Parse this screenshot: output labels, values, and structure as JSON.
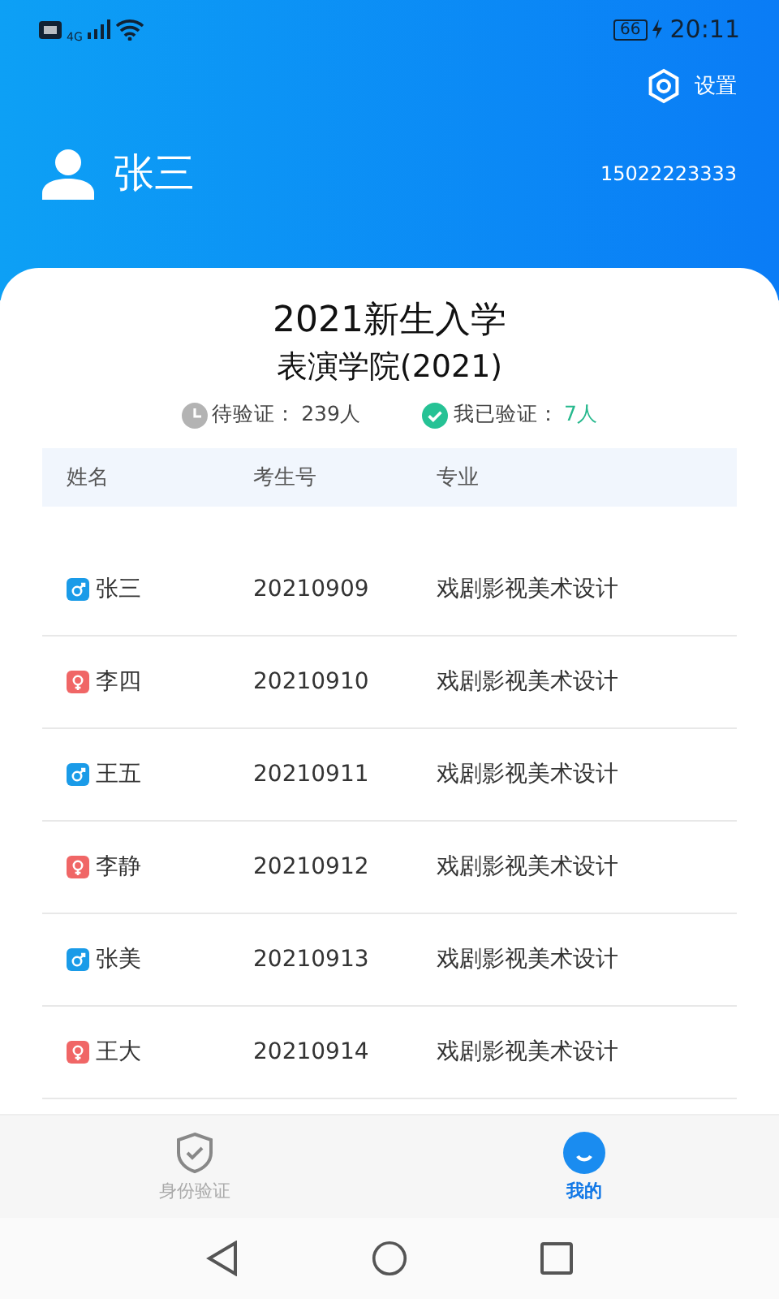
{
  "status_bar": {
    "network": "4G",
    "battery": "66",
    "time": "20:11"
  },
  "header": {
    "settings": "设置",
    "user_name": "张三",
    "phone": "15022223333"
  },
  "card": {
    "title": "2021新生入学",
    "subtitle": "表演学院(2021)",
    "stats": [
      {
        "kind": "pending",
        "label": "待验证：",
        "value": "239人"
      },
      {
        "kind": "verified",
        "label": "我已验证：",
        "value": "7人"
      }
    ]
  },
  "table": {
    "columns": [
      "姓名",
      "考生号",
      "专业"
    ],
    "rows": [
      {
        "kind": "male",
        "name": "张三",
        "id": "20210909",
        "major": "戏剧影视美术设计"
      },
      {
        "kind": "female",
        "name": "李四",
        "id": "20210910",
        "major": "戏剧影视美术设计"
      },
      {
        "kind": "male",
        "name": "王五",
        "id": "20210911",
        "major": "戏剧影视美术设计"
      },
      {
        "kind": "female",
        "name": "李静",
        "id": "20210912",
        "major": "戏剧影视美术设计"
      },
      {
        "kind": "male",
        "name": "张美",
        "id": "20210913",
        "major": "戏剧影视美术设计"
      },
      {
        "kind": "female",
        "name": "王大",
        "id": "20210914",
        "major": "戏剧影视美术设计"
      }
    ]
  },
  "tabs": [
    {
      "kind": "shield",
      "label": "身份验证",
      "selected": false
    },
    {
      "kind": "smile",
      "label": "我的",
      "selected": true
    }
  ]
}
